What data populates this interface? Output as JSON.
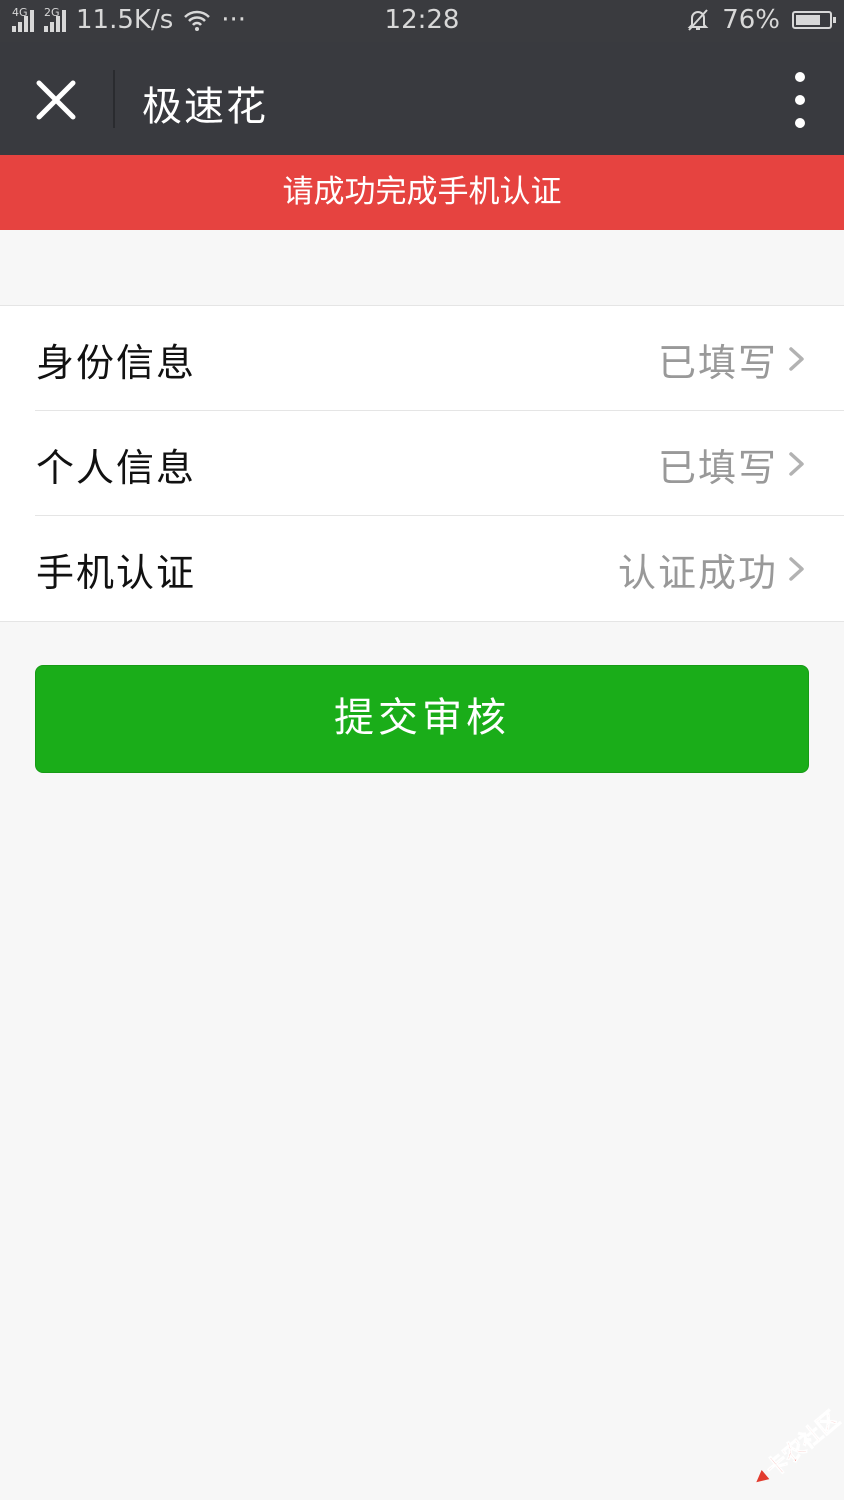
{
  "status_bar": {
    "network1": "4G",
    "network2": "2G",
    "speed": "11.5K/s",
    "more": "···",
    "time": "12:28",
    "battery": "76%",
    "battery_level": 0.76
  },
  "nav": {
    "title": "极速花",
    "close_icon": "close-icon",
    "more_icon": "more-vertical-icon"
  },
  "alert": {
    "text": "请成功完成手机认证",
    "color": "#e64340"
  },
  "list": {
    "items": [
      {
        "label": "身份信息",
        "value": "已填写"
      },
      {
        "label": "个人信息",
        "value": "已填写"
      },
      {
        "label": "手机认证",
        "value": "认证成功"
      }
    ]
  },
  "submit": {
    "label": "提交审核",
    "color": "#1aad19"
  },
  "watermark": {
    "text": "卡农社区"
  }
}
